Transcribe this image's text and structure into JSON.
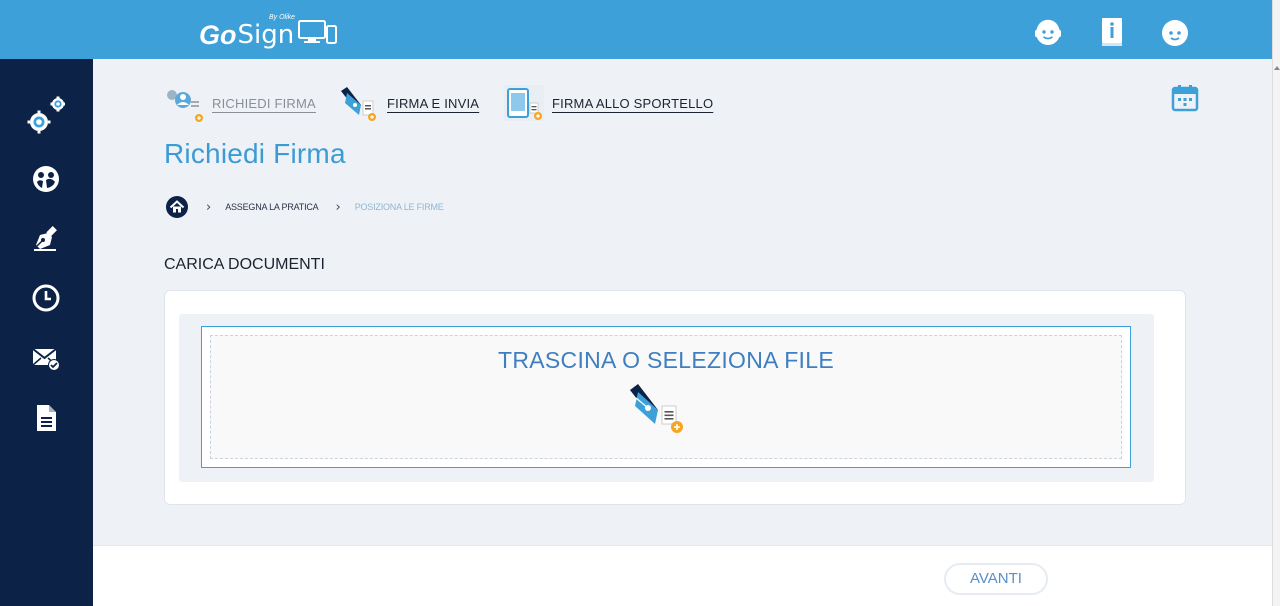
{
  "header": {
    "logo": {
      "brand_prefix": "Go",
      "brand_suffix": "Sign",
      "by_line": "By Olike"
    },
    "icons": [
      "support-headset-icon",
      "info-book-icon",
      "user-face-icon"
    ]
  },
  "sidebar": {
    "items": [
      {
        "icon": "settings-gears-icon"
      },
      {
        "icon": "dashboard-icon"
      },
      {
        "icon": "signature-pen-icon"
      },
      {
        "icon": "history-clock-icon"
      },
      {
        "icon": "mail-check-icon"
      },
      {
        "icon": "document-icon"
      }
    ]
  },
  "actions": [
    {
      "label": "RICHIEDI FIRMA",
      "icon": "request-signature-icon"
    },
    {
      "label": "FIRMA E INVIA",
      "icon": "sign-and-send-icon"
    },
    {
      "label": "FIRMA ALLO SPORTELLO",
      "icon": "counter-signature-icon"
    }
  ],
  "calendar_icon": "calendar-icon",
  "page": {
    "title": "Richiedi Firma"
  },
  "breadcrumb": {
    "home_icon": "home-icon",
    "steps": [
      "ASSEGNA LA PRATICA",
      "POSIZIONA LE FIRME"
    ]
  },
  "section": {
    "title": "CARICA DOCUMENTI"
  },
  "dropzone": {
    "text": "TRASCINA O SELEZIONA FILE",
    "icon": "signature-upload-icon"
  },
  "footer": {
    "next_label": "AVANTI"
  },
  "colors": {
    "primary": "#3ea0d9",
    "sidebar": "#0c2247",
    "title": "#3d9bd4",
    "accent_badge": "#f5a623"
  }
}
